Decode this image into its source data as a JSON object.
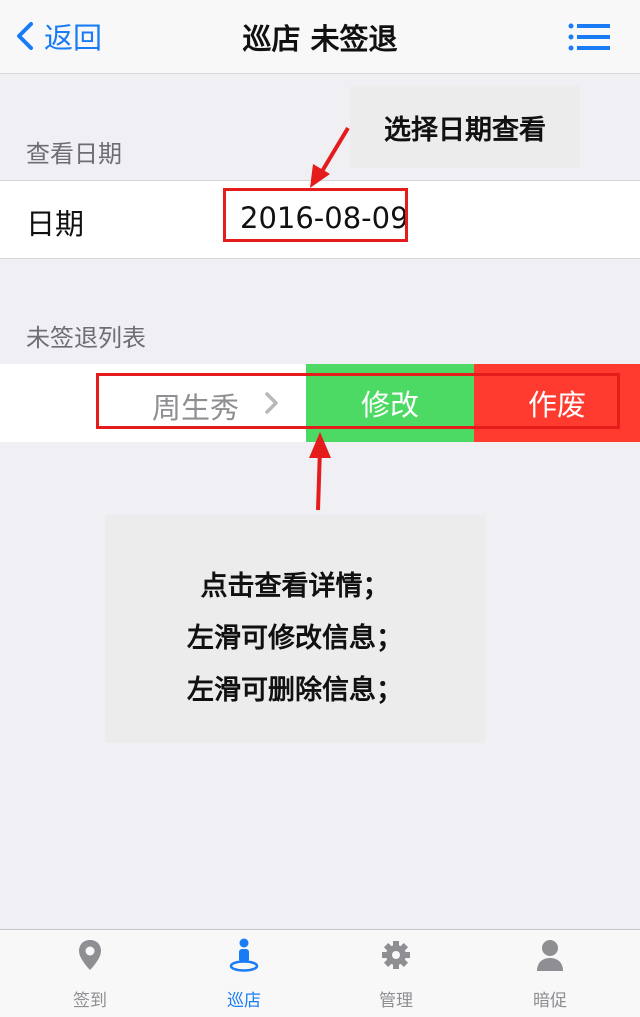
{
  "nav": {
    "back_label": "返回",
    "title": "巡店 未签退",
    "menu_icon": "list-menu-icon"
  },
  "date_section": {
    "header": "查看日期",
    "label": "日期",
    "value": "2016-08-09"
  },
  "list_section": {
    "header": "未签退列表",
    "items": [
      {
        "name": "周生秀",
        "edit_label": "修改",
        "void_label": "作废"
      }
    ]
  },
  "annotations": {
    "date_tip": "选择日期查看",
    "list_tips": [
      "点击查看详情；",
      "左滑可修改信息；",
      "左滑可删除信息；"
    ]
  },
  "tabbar": {
    "tabs": [
      {
        "label": "签到",
        "icon": "map-pin-icon",
        "active": false
      },
      {
        "label": "巡店",
        "icon": "person-location-icon",
        "active": true
      },
      {
        "label": "管理",
        "icon": "gear-icon",
        "active": false
      },
      {
        "label": "暗促",
        "icon": "user-icon",
        "active": false
      }
    ]
  },
  "colors": {
    "accent": "#1a7cf5",
    "edit_green": "#4cd964",
    "void_red": "#ff3b30",
    "annotation_red": "#e51c1c"
  }
}
